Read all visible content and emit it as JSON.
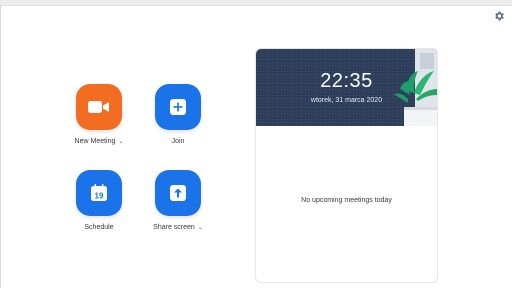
{
  "actions": {
    "new_meeting": {
      "label": "New Meeting",
      "has_dropdown": true,
      "icon": "video-camera-icon",
      "color": "#f26d21"
    },
    "join": {
      "label": "Join",
      "has_dropdown": false,
      "icon": "plus-icon",
      "color": "#1a73e8"
    },
    "schedule": {
      "label": "Schedule",
      "has_dropdown": false,
      "icon": "calendar-icon",
      "calendar_day": "19",
      "color": "#1a73e8"
    },
    "share_screen": {
      "label": "Share screen",
      "has_dropdown": true,
      "icon": "share-arrow-up-icon",
      "color": "#1a73e8"
    }
  },
  "meetings_panel": {
    "time": "22:35",
    "date": "wtorek, 31 marca 2020",
    "empty_message": "No upcoming meetings today",
    "banner_color": "#2c3e5b"
  },
  "header": {
    "settings_icon": "gear-icon"
  }
}
